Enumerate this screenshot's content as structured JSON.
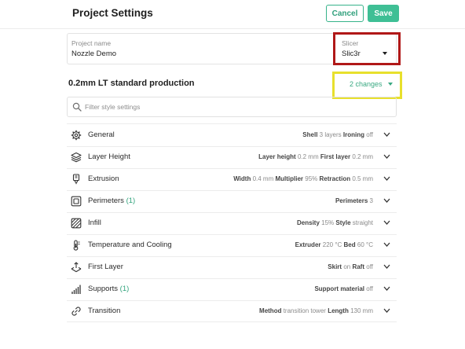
{
  "header": {
    "title": "Project Settings",
    "cancel_label": "Cancel",
    "save_label": "Save"
  },
  "project": {
    "name_label": "Project name",
    "name_value": "Nozzle Demo",
    "slicer_label": "Slicer",
    "slicer_value": "Slic3r"
  },
  "profile": {
    "title": "0.2mm LT standard production",
    "changes": "2 changes"
  },
  "filter": {
    "placeholder": "Filter style settings"
  },
  "rows": [
    {
      "label": "General",
      "icon": "gear-icon",
      "summary": [
        [
          "Shell",
          "3 layers"
        ],
        [
          "Ironing",
          "off"
        ]
      ]
    },
    {
      "label": "Layer Height",
      "icon": "layers-icon",
      "summary": [
        [
          "Layer height",
          "0.2 mm"
        ],
        [
          "First layer",
          "0.2 mm"
        ]
      ]
    },
    {
      "label": "Extrusion",
      "icon": "extruder-icon",
      "summary": [
        [
          "Width",
          "0.4 mm"
        ],
        [
          "Multiplier",
          "95%"
        ],
        [
          "Retraction",
          "0.5 mm"
        ]
      ]
    },
    {
      "label": "Perimeters",
      "count": "(1)",
      "icon": "perimeters-icon",
      "summary": [
        [
          "Perimeters",
          "3"
        ]
      ]
    },
    {
      "label": "Infill",
      "icon": "infill-icon",
      "summary": [
        [
          "Density",
          "15%"
        ],
        [
          "Style",
          "straight"
        ]
      ]
    },
    {
      "label": "Temperature and Cooling",
      "icon": "thermometer-icon",
      "summary": [
        [
          "Extruder",
          "220 °C"
        ],
        [
          "Bed",
          "60 °C"
        ]
      ]
    },
    {
      "label": "First Layer",
      "icon": "first-layer-icon",
      "summary": [
        [
          "Skirt",
          "on"
        ],
        [
          "Raft",
          "off"
        ]
      ]
    },
    {
      "label": "Supports",
      "count": "(1)",
      "icon": "supports-icon",
      "summary": [
        [
          "Support material",
          "off"
        ]
      ]
    },
    {
      "label": "Transition",
      "icon": "transition-icon",
      "summary": [
        [
          "Method",
          "transition tower"
        ],
        [
          "Length",
          "130 mm"
        ]
      ]
    }
  ],
  "colors": {
    "accent": "#3fbf95",
    "accent_text": "#2f9f7b",
    "slicer_highlight": "#b01818",
    "changes_highlight": "#e8e02c"
  }
}
